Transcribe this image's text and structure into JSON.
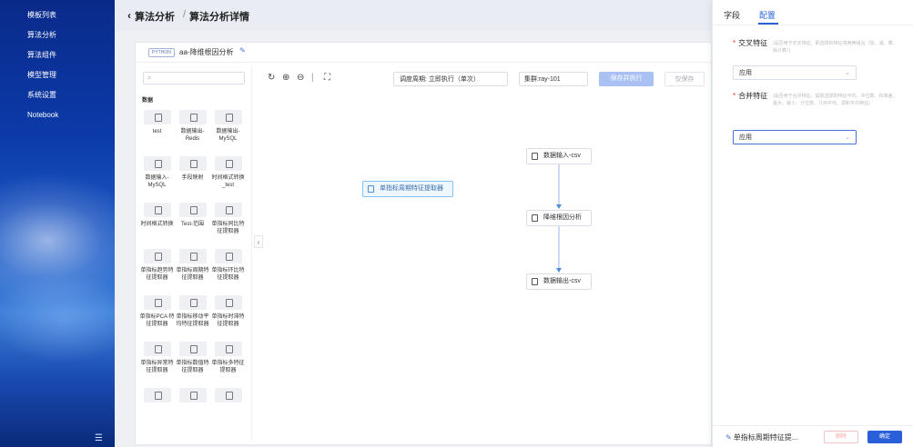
{
  "sidebar": {
    "items": [
      {
        "label": "模板列表"
      },
      {
        "label": "算法分析"
      },
      {
        "label": "算法组件"
      },
      {
        "label": "模型管理"
      },
      {
        "label": "系统设置"
      },
      {
        "label": "Notebook"
      }
    ],
    "collapse_icon": "menu-collapse-icon"
  },
  "header": {
    "back_icon": "‹",
    "title": "算法分析",
    "separator": "/",
    "subtitle": "算法分析详情"
  },
  "project": {
    "tag": "PYTHON",
    "name": "aa-降维根因分析"
  },
  "components": {
    "category": "数据",
    "items": [
      {
        "label": "test"
      },
      {
        "label": "数据输出-Redis"
      },
      {
        "label": "数据输出-MySQL"
      },
      {
        "label": "数据输入-MySQL"
      },
      {
        "label": "手段映射"
      },
      {
        "label": "时间格式转换_test"
      },
      {
        "label": "时间格式转换"
      },
      {
        "label": "Test-范围"
      },
      {
        "label": "单指标同比特征提取器"
      },
      {
        "label": "单指标趋势特征提取器"
      },
      {
        "label": "单指标周期特征提取器"
      },
      {
        "label": "单指标环比特征提取器"
      },
      {
        "label": "单指标PCA 特征提取器"
      },
      {
        "label": "单指标移动平均特征提取器"
      },
      {
        "label": "单指标时滞特征提取器"
      },
      {
        "label": "单指标异常特征提取器"
      },
      {
        "label": "单指标数值特征提取器"
      },
      {
        "label": "单指标多特征提取器"
      },
      {
        "label": ""
      },
      {
        "label": ""
      },
      {
        "label": ""
      }
    ]
  },
  "toolbar": {
    "schedule": "调度周期: 立即执行（单次）",
    "cluster": "集群:ray-101",
    "save_run": "保存并执行",
    "save_only": "仅保存"
  },
  "canvas": {
    "nodes": {
      "floating": "单指标周期特征提取器",
      "input": "数据输入-csv",
      "analysis": "降维根因分析",
      "output": "数据输出-csv"
    }
  },
  "panel": {
    "tabs": {
      "fields": "字段",
      "config": "配置"
    },
    "field1": {
      "label": "交叉特征",
      "hint": "(是否用于交叉特征，即选择的特征将两两组合（加、减、乘、除计算）)",
      "value": "应用"
    },
    "field2": {
      "label": "合并特征",
      "hint": "(是否用于合并特征，提取选择的特征平均、中位数、标准差、最大、最小、分位数、几何平均、调和平均特征)",
      "value": "应用"
    },
    "footer": {
      "node_name": "单指标周期特征提...",
      "delete": "删除",
      "ok": "确定"
    }
  },
  "colors": {
    "accent": "#2b5fd9",
    "save_run_disabled": "#a9c1f3",
    "selected_node": "#7fc4ef"
  }
}
